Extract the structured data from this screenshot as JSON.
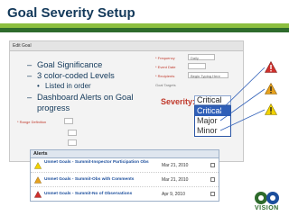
{
  "slide": {
    "title": "Goal Severity Setup",
    "bullets": [
      {
        "level": 1,
        "text": "Goal Significance"
      },
      {
        "level": 1,
        "text": "3 color-coded Levels"
      },
      {
        "level": 2,
        "text": "Listed  in  order"
      },
      {
        "level": 1,
        "text": "Dashboard Alerts on Goal progress"
      }
    ],
    "bullet_texts": {
      "b0": "Goal Significance",
      "b1": "3 color-coded Levels",
      "b2": "Listed  in  order",
      "b3": "Dashboard Alerts on Goal progress"
    }
  },
  "form": {
    "header": "Edit Goal",
    "frequency_label": "* Frequency",
    "frequency_value": "Daily",
    "event_date_label": "* Event Date",
    "recipients_label": "* Recipients",
    "recipients_value": "Begin Typing Here",
    "goal_targets_label": "Goal Targets",
    "range_definition_label": "* Range Definition"
  },
  "severity": {
    "label": "Severity:",
    "selected": "Critical",
    "options": [
      "Critical",
      "Major",
      "Minor"
    ]
  },
  "alerts": {
    "title": "Alerts",
    "items": [
      {
        "name": "Unmet Goals - Summit-Inspector Participation Obs",
        "date": "Mar 21, 2010",
        "severity": "minor"
      },
      {
        "name": "Unmet Goals - Summit-Obs with Comments",
        "date": "Mar 21, 2010",
        "severity": "major"
      },
      {
        "name": "Unmet Goals - Summit-No of Observations",
        "date": "Apr 9, 2010",
        "severity": "critical"
      }
    ]
  },
  "logo": {
    "text": "VISION"
  },
  "colors": {
    "title": "#13395a",
    "accent_green": "#8cbf3f",
    "dark_green": "#2e6b2c",
    "critical": "#d0312d",
    "major": "#e7a21c",
    "minor": "#f2d200",
    "selection_blue": "#2f5fb8"
  }
}
